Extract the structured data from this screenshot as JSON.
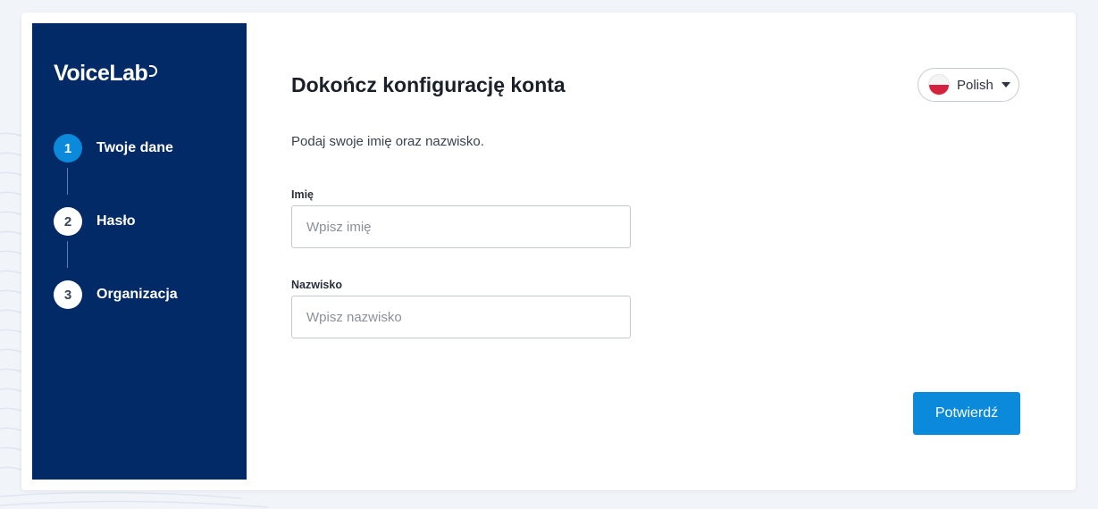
{
  "sidebar": {
    "logo_text": "VoiceLab",
    "steps": [
      {
        "number": "1",
        "label": "Twoje dane",
        "active": true
      },
      {
        "number": "2",
        "label": "Hasło",
        "active": false
      },
      {
        "number": "3",
        "label": "Organizacja",
        "active": false
      }
    ]
  },
  "header": {
    "title": "Dokończ konfigurację konta",
    "language": {
      "label": "Polish",
      "flag_icon": "poland-flag-icon"
    }
  },
  "form": {
    "description": "Podaj swoje imię oraz nazwisko.",
    "first_name": {
      "label": "Imię",
      "value": "",
      "placeholder": "Wpisz imię"
    },
    "last_name": {
      "label": "Nazwisko",
      "value": "",
      "placeholder": "Wpisz nazwisko"
    },
    "submit_label": "Potwierdź"
  },
  "colors": {
    "sidebar_bg": "#022a66",
    "accent": "#0b8adb",
    "page_bg": "#f1f4f8"
  }
}
